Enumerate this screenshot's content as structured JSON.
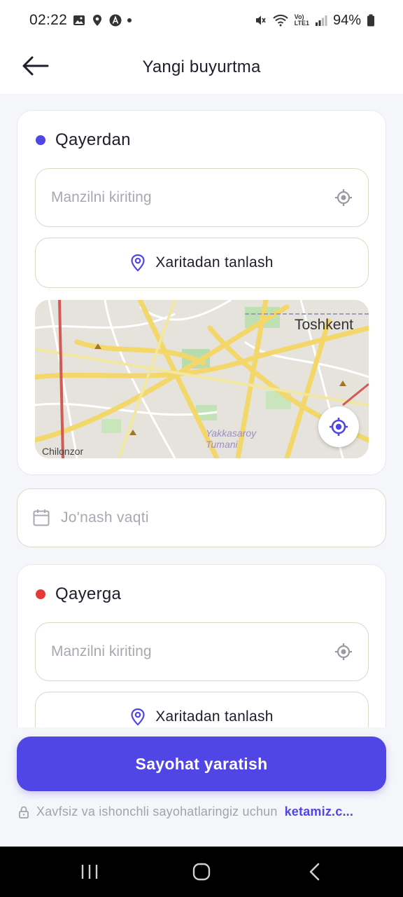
{
  "status_bar": {
    "time": "02:22",
    "battery": "94%",
    "network": "LTE1",
    "volte": "Vo)"
  },
  "app_bar": {
    "title": "Yangi buyurtma"
  },
  "from_section": {
    "title": "Qayerdan",
    "dot_color": "#4f46e5",
    "address_placeholder": "Manzilni kiriting",
    "pick_on_map_label": "Xaritadan tanlash",
    "map": {
      "city_label": "Toshkent",
      "district_label": "Yakkasaroy",
      "district_label_2": "Tumani",
      "corner_label": "Chilonzor"
    }
  },
  "departure_time": {
    "placeholder": "Jo'nash vaqti"
  },
  "to_section": {
    "title": "Qayerga",
    "dot_color": "#e53935",
    "address_placeholder": "Manzilni kiriting",
    "pick_on_map_label": "Xaritadan tanlash"
  },
  "footer": {
    "create_trip_label": "Sayohat yaratish",
    "note_text": "Xavfsiz va ishonchli sayohatlaringiz uchun",
    "note_link": "ketamiz.c..."
  },
  "colors": {
    "accent": "#4f46e5",
    "from_dot": "#4f46e5",
    "to_dot": "#e53935"
  }
}
